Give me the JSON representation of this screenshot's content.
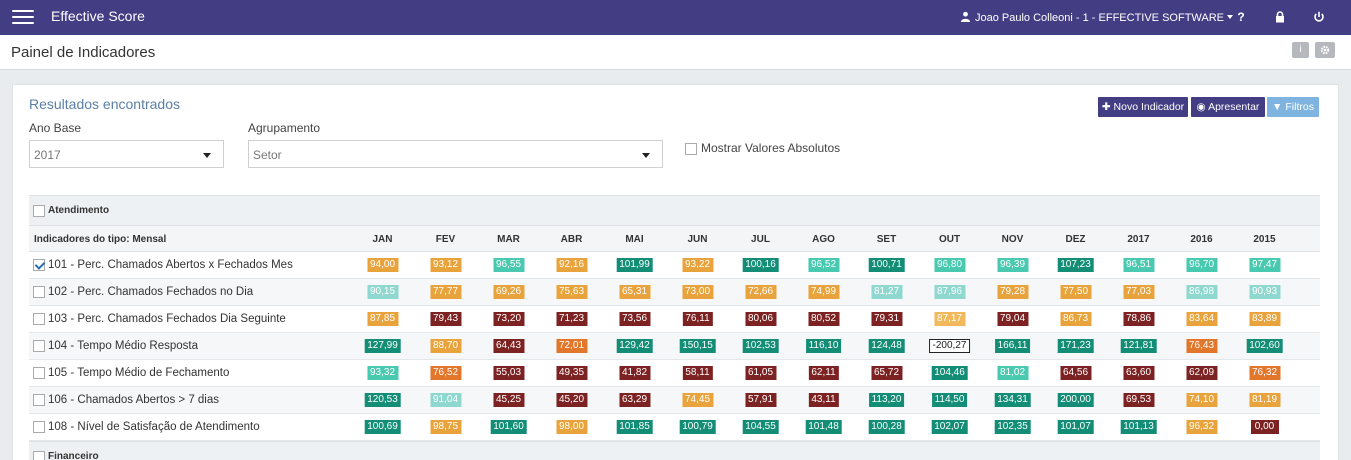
{
  "app": {
    "title": "Effective Score"
  },
  "user": {
    "label": "Joao Paulo Colleoni - 1 - EFFECTIVE SOFTWARE"
  },
  "topbar_icons": [
    "help-icon",
    "lock-icon",
    "power-icon"
  ],
  "page": {
    "title": "Painel de Indicadores"
  },
  "results": {
    "title": "Resultados encontrados"
  },
  "filters": {
    "ano_base_label": "Ano Base",
    "ano_base_value": "2017",
    "agrupamento_label": "Agrupamento",
    "agrupamento_value": "Setor",
    "absolutos_label": "Mostrar Valores Absolutos"
  },
  "actions": {
    "novo": "Novo Indicador",
    "apresentar": "Apresentar",
    "filtros": "Filtros"
  },
  "colors": {
    "topbar": "#433d84",
    "green": "#138d75",
    "teal": "#48c9b0",
    "light_teal": "#8fd8d0",
    "orange": "#e9a33c",
    "dark_orange": "#e2762b",
    "red": "#7d2222",
    "light_orange": "#f2b95c"
  },
  "table": {
    "group1": "Atendimento",
    "header_label": "Indicadores do tipo: Mensal",
    "columns": [
      "JAN",
      "FEV",
      "MAR",
      "ABR",
      "MAI",
      "JUN",
      "JUL",
      "AGO",
      "SET",
      "OUT",
      "NOV",
      "DEZ",
      "2017",
      "2016",
      "2015"
    ],
    "rows": [
      {
        "label": "101 - Perc. Chamados Abertos x Fechados Mes",
        "checked": true,
        "values": [
          "94,00",
          "93,12",
          "96,55",
          "92,16",
          "101,99",
          "93,22",
          "100,16",
          "96,52",
          "100,71",
          "96,80",
          "96,39",
          "107,23",
          "96,51",
          "96,70",
          "97,47"
        ],
        "colors": [
          "orange",
          "orange",
          "teal",
          "orange",
          "green",
          "orange",
          "green",
          "teal",
          "green",
          "teal",
          "teal",
          "green",
          "teal",
          "teal",
          "teal"
        ]
      },
      {
        "label": "102 - Perc. Chamados Fechados no Dia",
        "checked": false,
        "values": [
          "90,15",
          "77,77",
          "69,26",
          "75,63",
          "65,31",
          "73,00",
          "72,66",
          "74,99",
          "81,27",
          "87,96",
          "79,28",
          "77,50",
          "77,03",
          "86,98",
          "90,93"
        ],
        "colors": [
          "light_teal",
          "orange",
          "orange",
          "orange",
          "orange",
          "orange",
          "orange",
          "orange",
          "light_teal",
          "light_teal",
          "orange",
          "orange",
          "orange",
          "light_teal",
          "light_teal"
        ]
      },
      {
        "label": "103 - Perc. Chamados Fechados Dia Seguinte",
        "checked": false,
        "values": [
          "87,85",
          "79,43",
          "73,20",
          "71,23",
          "73,56",
          "76,11",
          "80,06",
          "80,52",
          "79,31",
          "87,17",
          "79,04",
          "86,73",
          "78,86",
          "83,64",
          "83,89"
        ],
        "colors": [
          "orange",
          "red",
          "red",
          "red",
          "red",
          "red",
          "red",
          "red",
          "red",
          "light_orange",
          "red",
          "orange",
          "red",
          "orange",
          "orange"
        ]
      },
      {
        "label": "104 - Tempo Médio Resposta",
        "checked": false,
        "values": [
          "127,99",
          "88,70",
          "64,43",
          "72,01",
          "129,42",
          "150,15",
          "102,53",
          "116,10",
          "124,48",
          "-200,27",
          "166,11",
          "171,23",
          "121,81",
          "76,43",
          "102,60"
        ],
        "colors": [
          "green",
          "orange",
          "red",
          "dark_orange",
          "green",
          "green",
          "green",
          "green",
          "green",
          "outline",
          "green",
          "green",
          "green",
          "dark_orange",
          "green"
        ]
      },
      {
        "label": "105 - Tempo Médio de Fechamento",
        "checked": false,
        "values": [
          "93,32",
          "76,52",
          "55,03",
          "49,35",
          "41,82",
          "58,11",
          "61,05",
          "62,11",
          "65,72",
          "104,46",
          "81,02",
          "64,56",
          "63,60",
          "62,09",
          "76,32"
        ],
        "colors": [
          "teal",
          "dark_orange",
          "red",
          "red",
          "red",
          "red",
          "red",
          "red",
          "red",
          "green",
          "teal",
          "red",
          "red",
          "red",
          "dark_orange"
        ]
      },
      {
        "label": "106 - Chamados Abertos > 7 dias",
        "checked": false,
        "values": [
          "120,53",
          "91,04",
          "45,25",
          "45,20",
          "63,29",
          "74,45",
          "57,91",
          "43,11",
          "113,20",
          "114,50",
          "134,31",
          "200,00",
          "69,53",
          "74,10",
          "81,19"
        ],
        "colors": [
          "green",
          "light_teal",
          "red",
          "red",
          "red",
          "orange",
          "red",
          "red",
          "green",
          "green",
          "green",
          "green",
          "red",
          "orange",
          "orange"
        ]
      },
      {
        "label": "108 - Nível de Satisfação de Atendimento",
        "checked": false,
        "values": [
          "100,69",
          "98,75",
          "101,60",
          "98,00",
          "101,85",
          "100,79",
          "104,55",
          "101,48",
          "100,28",
          "102,07",
          "102,35",
          "101,07",
          "101,13",
          "96,32",
          "0,00"
        ],
        "colors": [
          "green",
          "orange",
          "green",
          "orange",
          "green",
          "green",
          "green",
          "green",
          "green",
          "green",
          "green",
          "green",
          "green",
          "orange",
          "red"
        ]
      }
    ],
    "group2": "Financeiro"
  }
}
